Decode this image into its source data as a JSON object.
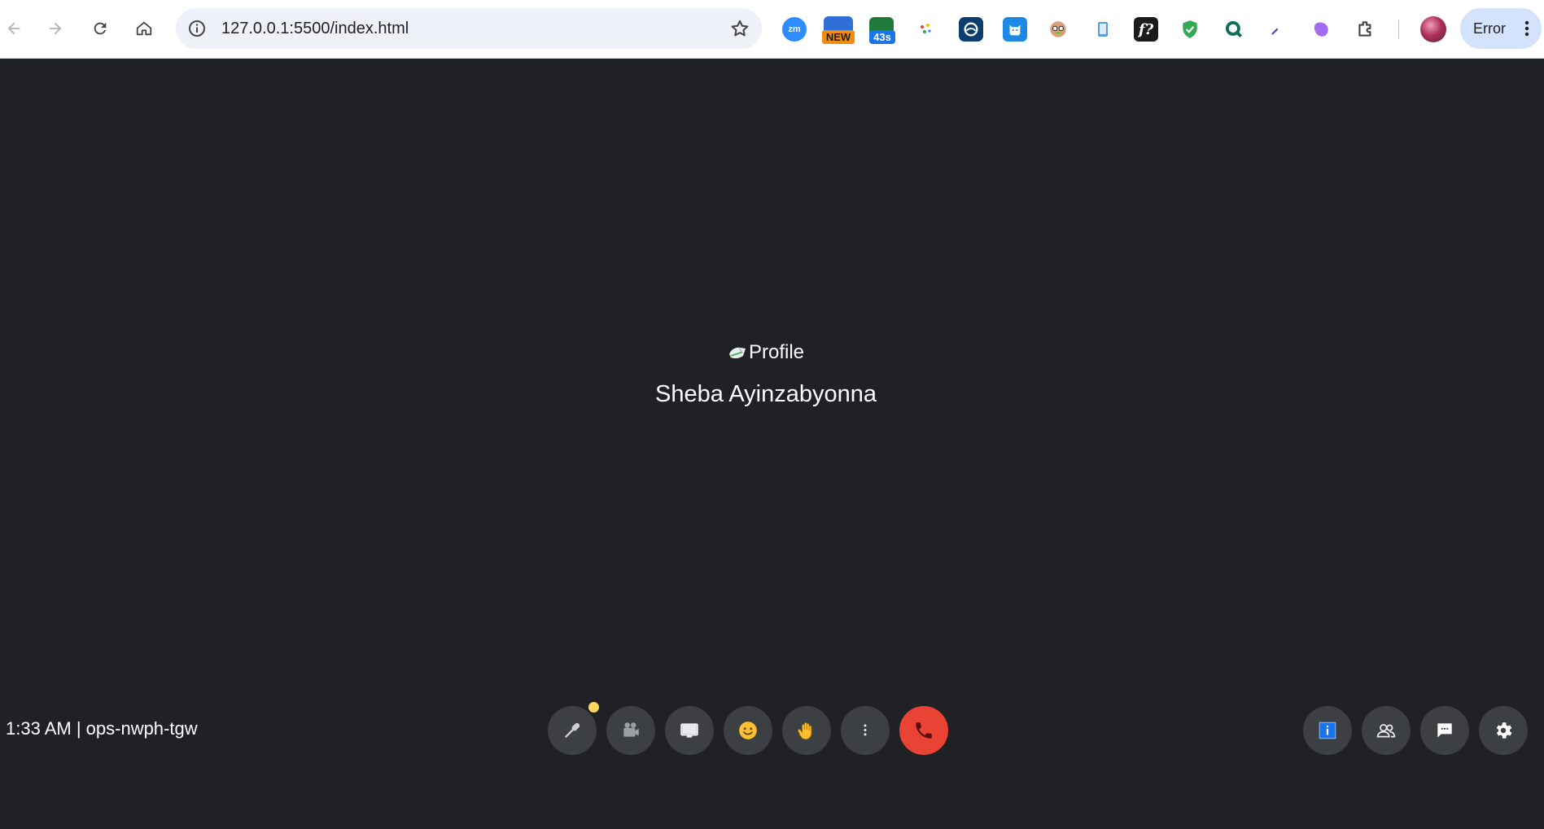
{
  "browser": {
    "url": "127.0.0.1:5500/index.html",
    "extensions": {
      "zoom_label": "zm",
      "new_badge": "NEW",
      "timer_badge": "43s",
      "f_label": "f?"
    },
    "profile_button_label": "Error"
  },
  "stage": {
    "profile_image_alt": "Profile",
    "participant_name": "Sheba Ayinzabyonna"
  },
  "footer": {
    "meeting_info": "1:33 AM | ops-nwph-tgw"
  },
  "colors": {
    "background": "#202124",
    "control_button": "#3c4043",
    "end_call": "#ea4335",
    "mic_indicator": "#fdd663",
    "info_icon": "#1a73e8"
  }
}
